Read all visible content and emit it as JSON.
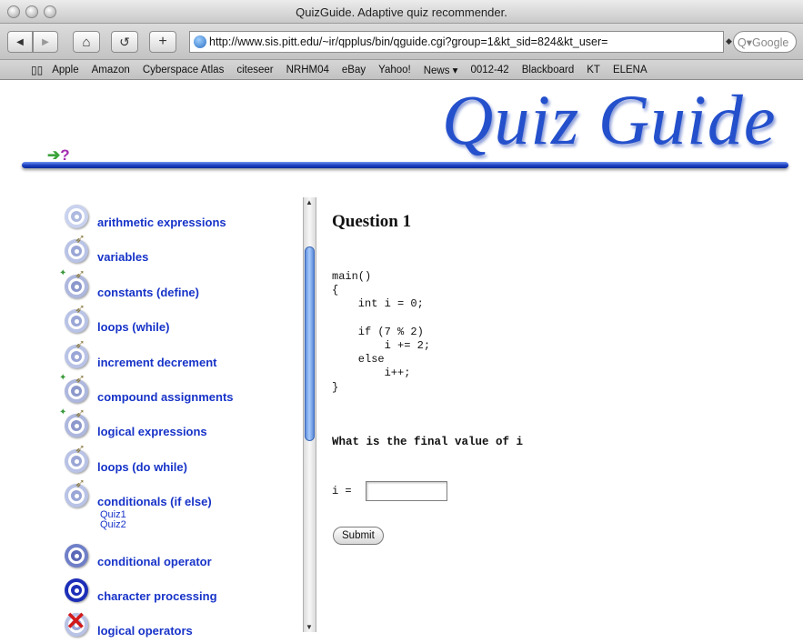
{
  "window": {
    "title": "QuizGuide. Adaptive quiz recommender."
  },
  "toolbar": {
    "back_glyph": "◀",
    "forward_glyph": "▶",
    "home_glyph": "⌂",
    "reload_glyph": "↺",
    "add_glyph": "+",
    "url": "http://www.sis.pitt.edu/~ir/qpplus/bin/qguide.cgi?group=1&kt_sid=824&kt_user=",
    "search_placeholder": "Q▾Google"
  },
  "bookmarks": {
    "book_glyph": "📖",
    "items": [
      "Apple",
      "Amazon",
      "Cyberspace Atlas",
      "citeseer",
      "NRHM04",
      "eBay",
      "Yahoo!",
      "News ▾",
      "0012-42",
      "Blackboard",
      "KT",
      "ELENA"
    ]
  },
  "header": {
    "logo_text": "Quiz Guide",
    "help_arrow": "➔",
    "help_mark": "?"
  },
  "topics": [
    {
      "label": "arithmetic expressions",
      "icon": "target-light-icon"
    },
    {
      "label": "variables",
      "icon": "target-arrow-icon"
    },
    {
      "label": "constants (define)",
      "icon": "target-arrows-icon"
    },
    {
      "label": "loops (while)",
      "icon": "target-arrow-icon"
    },
    {
      "label": "increment decrement",
      "icon": "target-arrow-icon"
    },
    {
      "label": "compound assignments",
      "icon": "target-arrows-icon"
    },
    {
      "label": "logical expressions",
      "icon": "target-arrows-icon"
    },
    {
      "label": "loops (do while)",
      "icon": "target-arrow-icon"
    },
    {
      "label": "conditionals (if else)",
      "icon": "target-arrow-icon",
      "quizzes": [
        "Quiz1",
        "Quiz2"
      ]
    },
    {
      "label": "conditional operator",
      "icon": "target-medium-icon"
    },
    {
      "label": "character processing",
      "icon": "target-dark-icon"
    },
    {
      "label": "logical operators",
      "icon": "target-crossed-icon"
    }
  ],
  "question": {
    "title": "Question 1",
    "code": "main()\n{\n    int i = 0;\n\n    if (7 % 2)\n        i += 2;\n    else\n        i++;\n}",
    "prompt": "What is the final value of i",
    "answer_label": "i =",
    "answer_value": "",
    "submit_label": "Submit"
  },
  "colors": {
    "link": "#1733c8",
    "accent": "#2450cc"
  }
}
